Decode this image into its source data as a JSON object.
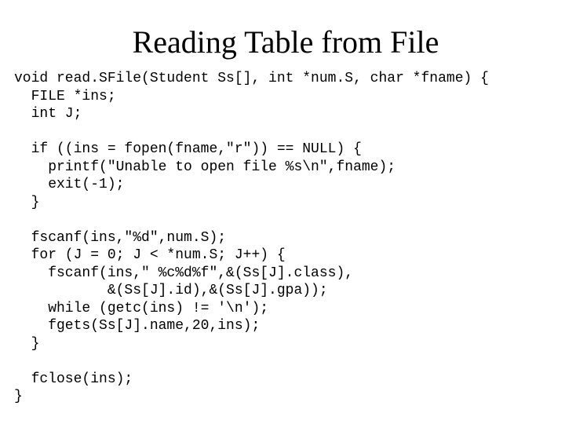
{
  "title": "Reading Table from File",
  "code": "void read.SFile(Student Ss[], int *num.S, char *fname) {\n  FILE *ins;\n  int J;\n\n  if ((ins = fopen(fname,\"r\")) == NULL) {\n    printf(\"Unable to open file %s\\n\",fname);\n    exit(-1);\n  }\n\n  fscanf(ins,\"%d\",num.S);\n  for (J = 0; J < *num.S; J++) {\n    fscanf(ins,\" %c%d%f\",&(Ss[J].class),\n           &(Ss[J].id),&(Ss[J].gpa));\n    while (getc(ins) != '\\n');\n    fgets(Ss[J].name,20,ins);\n  }\n\n  fclose(ins);\n}"
}
